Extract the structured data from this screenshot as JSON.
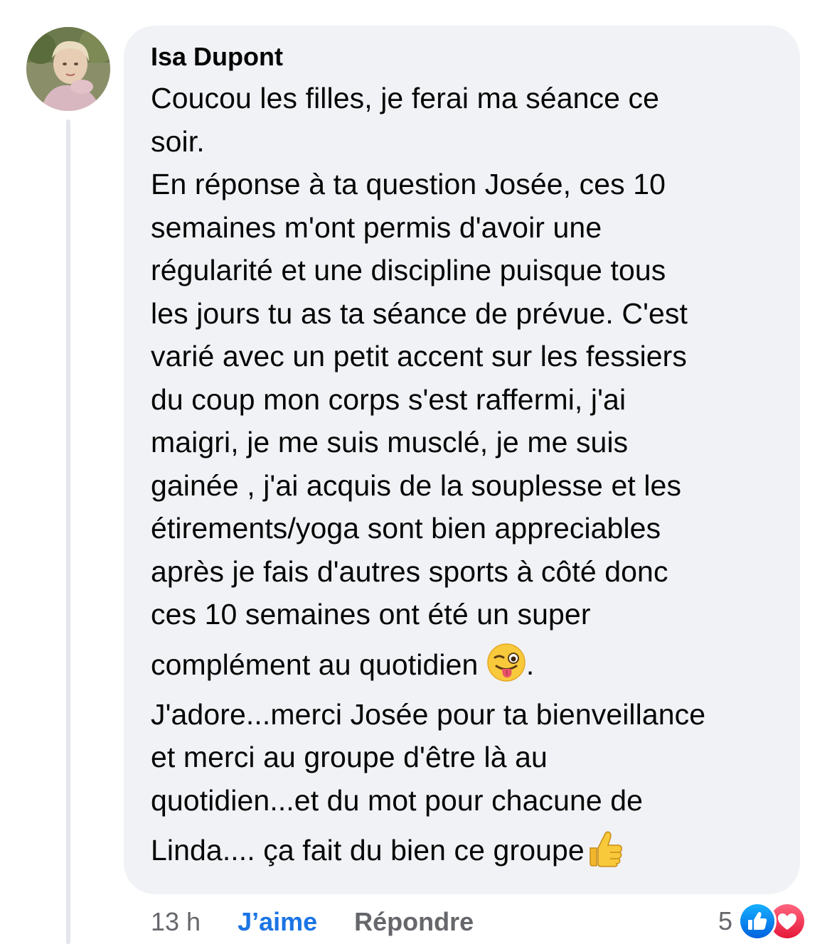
{
  "comment": {
    "author": "Isa Dupont",
    "lines": [
      "Coucou les filles, je ferai ma séance ce",
      "soir.",
      "En réponse à ta question Josée, ces 10",
      "semaines m'ont permis d'avoir une",
      "régularité et une discipline puisque tous",
      "les jours tu as ta séance de prévue. C'est",
      "varié avec un petit accent sur les fessiers",
      "du coup mon corps s'est raffermi, j'ai",
      "maigri, je me suis musclé, je me suis",
      "gainée , j'ai acquis de la souplesse et les",
      "étirements/yoga sont bien appreciables",
      "après je fais d'autres sports à côté donc",
      "ces 10 semaines ont été un super"
    ],
    "line_with_wink_before": "complément au quotidien ",
    "line_with_wink_after": ".",
    "lines_after": [
      "J'adore...merci Josée pour ta bienveillance",
      "et merci au groupe d'être là au",
      "quotidien...et du mot pour chacune de"
    ],
    "last_line": "Linda.... ça fait du bien ce groupe",
    "emojis": {
      "wink": "winking-face-with-tongue",
      "thumbs": "thumbs-up"
    }
  },
  "actions": {
    "time": "13 h",
    "like_label": "J’aime",
    "reply_label": "Répondre",
    "reaction_count": "5",
    "reaction_icons": [
      "like-icon",
      "love-icon"
    ]
  },
  "colors": {
    "bubble": "#f0f2f5",
    "like_blue": "#1b74e4",
    "muted": "#65676b",
    "love_red": "#f33e58"
  }
}
